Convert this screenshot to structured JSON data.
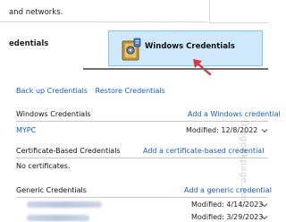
{
  "header": {
    "networks_text": "and networks.",
    "web_credentials_label": "edentials",
    "windows_credentials_tile": "Windows Credentials"
  },
  "actions": {
    "backup": "Back up Credentials",
    "restore": "Restore Credentials"
  },
  "sections": {
    "windows": {
      "title": "Windows Credentials",
      "add": "Add a Windows credential",
      "entries": [
        {
          "name": "MYPC",
          "modified": "Modified:  12/8/2022"
        }
      ]
    },
    "certificate": {
      "title": "Certificate-Based Credentials",
      "add": "Add a certificate-based credential",
      "empty": "No certificates."
    },
    "generic": {
      "title": "Generic Credentials",
      "add": "Add a generic credential",
      "entries": [
        {
          "modified": "Modified:  4/14/2023"
        },
        {
          "modified": "Modified:  3/29/2023"
        }
      ]
    }
  },
  "watermark": "thegeekpage.com",
  "colors": {
    "tile_bg": "#cfe8fb",
    "link": "#1a5fb4",
    "arrow": "#d9363e"
  },
  "icons": {
    "vault": "credential-vault-icon",
    "arrow": "red-pointer-arrow",
    "chevron": "chevron-down-icon"
  }
}
